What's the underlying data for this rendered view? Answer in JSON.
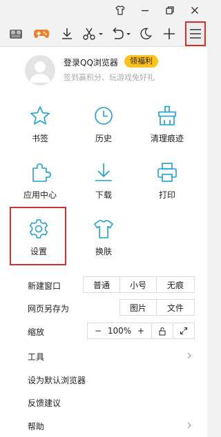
{
  "toolbar": {
    "menu_label": "菜单"
  },
  "profile": {
    "login": "登录QQ浏览器",
    "badge": "领福利",
    "subtitle": "签到赢积分、玩游戏免好礼"
  },
  "grid": [
    {
      "label": "书签",
      "icon": "star-icon"
    },
    {
      "label": "历史",
      "icon": "clock-icon"
    },
    {
      "label": "清理痕迹",
      "icon": "broom-icon"
    },
    {
      "label": "应用中心",
      "icon": "puzzle-icon"
    },
    {
      "label": "下载",
      "icon": "download-icon"
    },
    {
      "label": "打印",
      "icon": "printer-icon"
    },
    {
      "label": "设置",
      "icon": "gear-icon"
    },
    {
      "label": "换肤",
      "icon": "shirt-icon"
    }
  ],
  "new_window": {
    "label": "新建窗口",
    "options": [
      "普通",
      "小号",
      "无痕"
    ]
  },
  "save_page": {
    "label": "网页另存为",
    "options": [
      "图片",
      "文件"
    ]
  },
  "zoom": {
    "label": "缩放",
    "minus": "−",
    "value": "100%",
    "plus": "+"
  },
  "menu": {
    "tools": "工具",
    "default_browser": "设为默认浏览器",
    "feedback": "反馈建议",
    "help": "帮助"
  },
  "colors": {
    "accent": "#1aa0d8",
    "highlight": "#d32f2f",
    "badge": "#ffc21a"
  }
}
